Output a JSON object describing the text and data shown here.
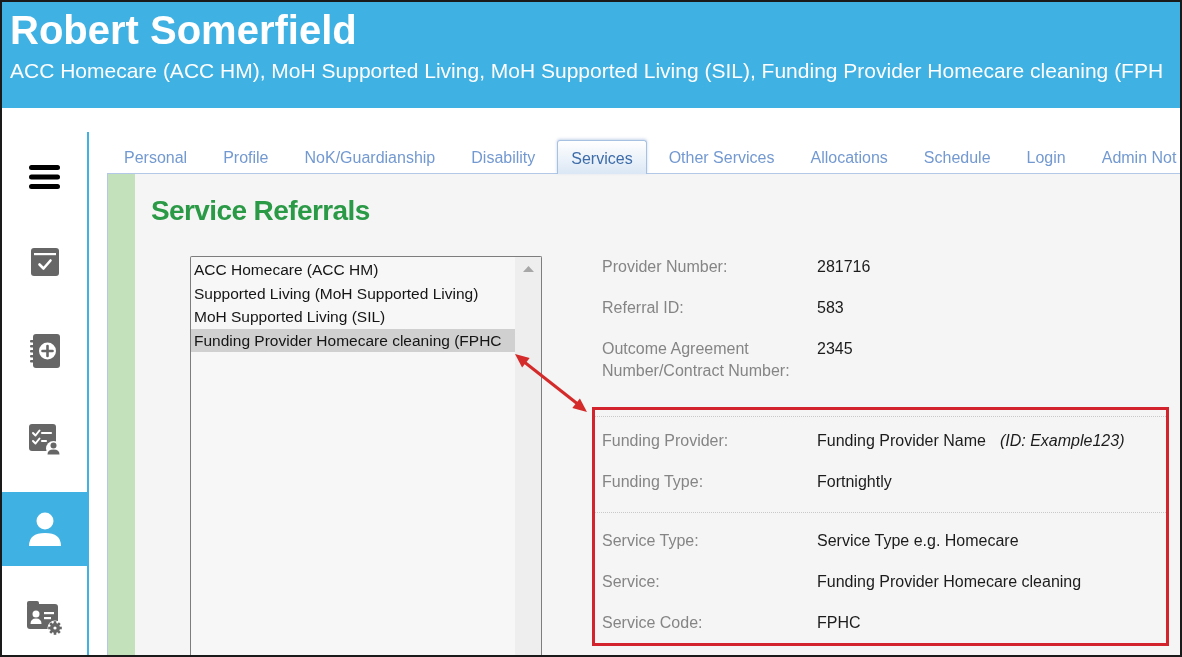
{
  "header": {
    "title": "Robert Somerfield",
    "subtitle": "ACC Homecare (ACC HM), MoH Supported Living, MoH Supported Living (SIL), Funding Provider Homecare cleaning (FPH"
  },
  "sidebar": {
    "items": [
      {
        "selected": false
      },
      {
        "selected": false
      },
      {
        "selected": false
      },
      {
        "selected": true
      },
      {
        "selected": false
      }
    ]
  },
  "tabs": [
    {
      "label": "Personal",
      "selected": false
    },
    {
      "label": "Profile",
      "selected": false
    },
    {
      "label": "NoK/Guardianship",
      "selected": false
    },
    {
      "label": "Disability",
      "selected": false
    },
    {
      "label": "Services",
      "selected": true
    },
    {
      "label": "Other Services",
      "selected": false
    },
    {
      "label": "Allocations",
      "selected": false
    },
    {
      "label": "Schedule",
      "selected": false
    },
    {
      "label": "Login",
      "selected": false
    },
    {
      "label": "Admin Not",
      "selected": false
    }
  ],
  "section": {
    "title": "Service Referrals"
  },
  "referral_list": {
    "items": [
      {
        "label": "ACC Homecare (ACC HM)",
        "selected": false
      },
      {
        "label": "Supported Living (MoH Supported Living)",
        "selected": false
      },
      {
        "label": "MoH Supported Living (SIL)",
        "selected": false
      },
      {
        "label": "Funding Provider Homecare cleaning (FPHC",
        "selected": true
      }
    ]
  },
  "details": {
    "fields": [
      {
        "label": "Provider Number:",
        "value": "281716"
      },
      {
        "label": "Referral ID:",
        "value": "583"
      },
      {
        "label": "Outcome Agreement Number/Contract Number:",
        "value": "2345"
      }
    ],
    "highlighted_groups": [
      {
        "fields": [
          {
            "label": "Funding Provider:",
            "value": "Funding Provider Name",
            "note": "(ID: Example123)"
          },
          {
            "label": "Funding Type:",
            "value": "Fortnightly"
          }
        ]
      },
      {
        "fields": [
          {
            "label": "Service Type:",
            "value": "Service Type e.g. Homecare"
          },
          {
            "label": "Service:",
            "value": "Funding Provider Homecare cleaning"
          },
          {
            "label": "Service Code:",
            "value": "FPHC"
          }
        ]
      }
    ]
  }
}
